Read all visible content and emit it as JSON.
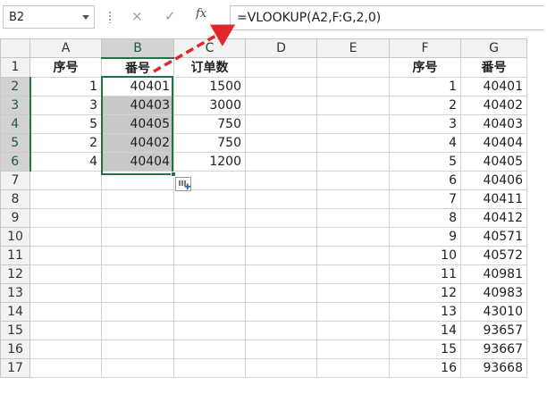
{
  "formula_bar": {
    "name_box": "B2",
    "cancel_icon": "×",
    "enter_icon": "✓",
    "fx_label": "fx",
    "formula": "=VLOOKUP(A2,F:G,2,0)"
  },
  "columns": [
    "A",
    "B",
    "C",
    "D",
    "E",
    "F",
    "G"
  ],
  "rows": [
    {
      "n": "1",
      "A": "序号",
      "B": "番号",
      "C": "订单数",
      "D": "",
      "E": "",
      "F": "序号",
      "G": "番号"
    },
    {
      "n": "2",
      "A": "1",
      "B": "40401",
      "C": "1500",
      "D": "",
      "E": "",
      "F": "1",
      "G": "40401"
    },
    {
      "n": "3",
      "A": "3",
      "B": "40403",
      "C": "3000",
      "D": "",
      "E": "",
      "F": "2",
      "G": "40402"
    },
    {
      "n": "4",
      "A": "5",
      "B": "40405",
      "C": "750",
      "D": "",
      "E": "",
      "F": "3",
      "G": "40403"
    },
    {
      "n": "5",
      "A": "2",
      "B": "40402",
      "C": "750",
      "D": "",
      "E": "",
      "F": "4",
      "G": "40404"
    },
    {
      "n": "6",
      "A": "4",
      "B": "40404",
      "C": "1200",
      "D": "",
      "E": "",
      "F": "5",
      "G": "40405"
    },
    {
      "n": "7",
      "A": "",
      "B": "",
      "C": "",
      "D": "",
      "E": "",
      "F": "6",
      "G": "40406"
    },
    {
      "n": "8",
      "A": "",
      "B": "",
      "C": "",
      "D": "",
      "E": "",
      "F": "7",
      "G": "40411"
    },
    {
      "n": "9",
      "A": "",
      "B": "",
      "C": "",
      "D": "",
      "E": "",
      "F": "8",
      "G": "40412"
    },
    {
      "n": "10",
      "A": "",
      "B": "",
      "C": "",
      "D": "",
      "E": "",
      "F": "9",
      "G": "40571"
    },
    {
      "n": "11",
      "A": "",
      "B": "",
      "C": "",
      "D": "",
      "E": "",
      "F": "10",
      "G": "40572"
    },
    {
      "n": "12",
      "A": "",
      "B": "",
      "C": "",
      "D": "",
      "E": "",
      "F": "11",
      "G": "40981"
    },
    {
      "n": "13",
      "A": "",
      "B": "",
      "C": "",
      "D": "",
      "E": "",
      "F": "12",
      "G": "40983"
    },
    {
      "n": "14",
      "A": "",
      "B": "",
      "C": "",
      "D": "",
      "E": "",
      "F": "13",
      "G": "43010"
    },
    {
      "n": "15",
      "A": "",
      "B": "",
      "C": "",
      "D": "",
      "E": "",
      "F": "14",
      "G": "93657"
    },
    {
      "n": "16",
      "A": "",
      "B": "",
      "C": "",
      "D": "",
      "E": "",
      "F": "15",
      "G": "93667"
    },
    {
      "n": "17",
      "A": "",
      "B": "",
      "C": "",
      "D": "",
      "E": "",
      "F": "16",
      "G": "93668"
    }
  ],
  "selection": {
    "active_cell": "B2",
    "range": "B2:B6"
  },
  "colors": {
    "accent": "#217346",
    "annotation_arrow": "#e0282b",
    "selection_fill": "#c8c8c8"
  },
  "icons": {
    "quick_analysis": "quick-analysis-icon",
    "fill_handle": "fill-handle"
  }
}
